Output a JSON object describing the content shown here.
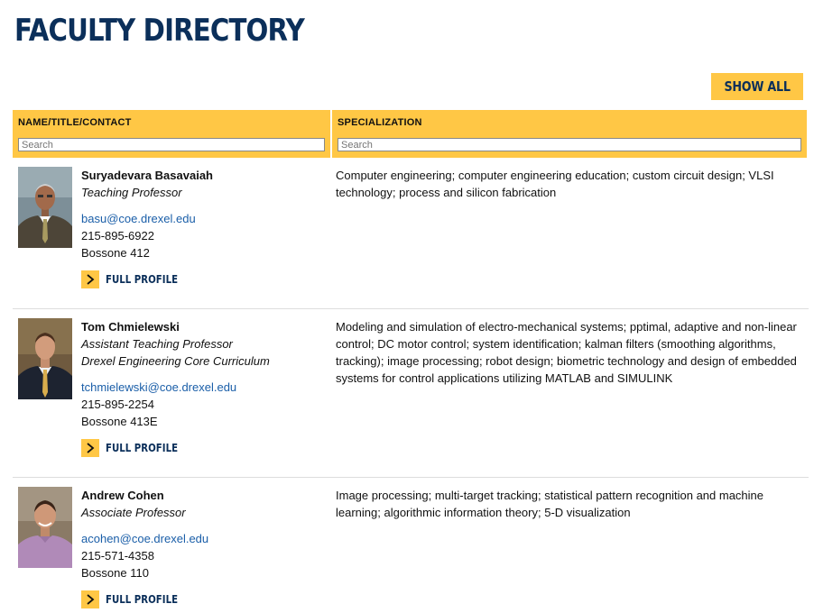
{
  "page": {
    "title": "Faculty Directory"
  },
  "toolbar": {
    "show_all_label": "Show All"
  },
  "table": {
    "columns": [
      {
        "label": "NAME/TITLE/CONTACT",
        "search_placeholder": "Search"
      },
      {
        "label": "SPECIALIZATION",
        "search_placeholder": "Search"
      }
    ],
    "rows": [
      {
        "name": "Suryadevara Basavaiah",
        "titles": [
          "Teaching Professor"
        ],
        "email": "basu@coe.drexel.edu",
        "phone": "215-895-6922",
        "office": "Bossone 412",
        "profile_label": "Full Profile",
        "specialization": "Computer engineering; computer engineering education; custom circuit design; VLSI technology; process and silicon fabrication"
      },
      {
        "name": "Tom Chmielewski",
        "titles": [
          "Assistant Teaching Professor",
          "Drexel Engineering Core Curriculum"
        ],
        "email": "tchmielewski@coe.drexel.edu",
        "phone": "215-895-2254",
        "office": "Bossone 413E",
        "profile_label": "Full Profile",
        "specialization": "Modeling and simulation of electro-mechanical systems; pptimal, adaptive and non-linear control; DC motor control; system identification; kalman filters (smoothing algorithms, tracking); image processing; robot design; biometric technology and design of embedded systems for control applications utilizing MATLAB and SIMULINK"
      },
      {
        "name": "Andrew Cohen",
        "titles": [
          "Associate Professor"
        ],
        "email": "acohen@coe.drexel.edu",
        "phone": "215-571-4358",
        "office": "Bossone 110",
        "profile_label": "Full Profile",
        "specialization": "Image processing; multi-target tracking; statistical pattern recognition and machine learning; algorithmic information theory; 5-D visualization"
      }
    ]
  },
  "icons": {
    "profile_arrow": "chevron-right-icon"
  },
  "colors": {
    "accent": "#ffc745",
    "navy": "#0b2f5a",
    "link": "#1a5ea8"
  }
}
